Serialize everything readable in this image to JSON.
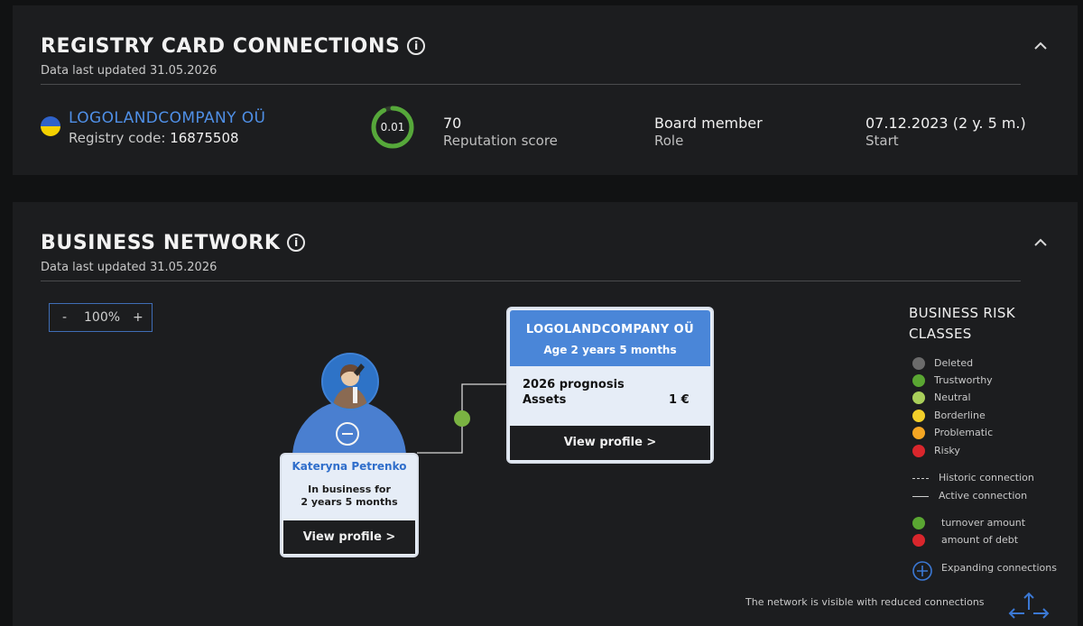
{
  "registry": {
    "title": "REGISTRY CARD CONNECTIONS",
    "info_icon": "i",
    "updated": "Data last updated 31.05.2026",
    "company_name": "LOGOLANDCOMPANY OÜ",
    "registry_code_label": "Registry code:",
    "registry_code": "16875508",
    "score_ring_value": "0.01",
    "reputation_value": "70",
    "reputation_label": "Reputation score",
    "role_value": "Board member",
    "role_label": "Role",
    "start_value": "07.12.2023 (2 y. 5 m.)",
    "start_label": "Start",
    "flag_colors": [
      "#2f62c9",
      "#f4d100"
    ]
  },
  "network": {
    "title": "BUSINESS NETWORK",
    "info_icon": "i",
    "updated": "Data last updated 31.05.2026",
    "zoom": {
      "minus": "-",
      "level": "100%",
      "plus": "+"
    },
    "person": {
      "name": "Kateryna Petrenko",
      "since_line1": "In business for",
      "since_line2": "2 years 5 months",
      "view_profile": "View profile >"
    },
    "company": {
      "name": "LOGOLANDCOMPANY OÜ",
      "age": "Age 2 years 5 months",
      "prognosis": "2026 prognosis",
      "assets_label": "Assets",
      "assets_value": "1 €",
      "view_profile": "View profile >"
    },
    "legend": {
      "title_line1": "BUSINESS RISK",
      "title_line2": "CLASSES",
      "classes": [
        {
          "label": "Deleted",
          "color": "#6b6b6b"
        },
        {
          "label": "Trustworthy",
          "color": "#5aa632"
        },
        {
          "label": "Neutral",
          "color": "#a9cf5a"
        },
        {
          "label": "Borderline",
          "color": "#f2cf2a"
        },
        {
          "label": "Problematic",
          "color": "#f5a623"
        },
        {
          "label": "Risky",
          "color": "#d9262c"
        }
      ],
      "historic": "Historic connection",
      "active": "Active connection",
      "turnover": "turnover amount",
      "debt": "amount of debt",
      "turnover_color": "#5aa632",
      "debt_color": "#d9262c",
      "expanding": "Expanding connections"
    },
    "footer_note": "The network is visible with reduced connections"
  }
}
